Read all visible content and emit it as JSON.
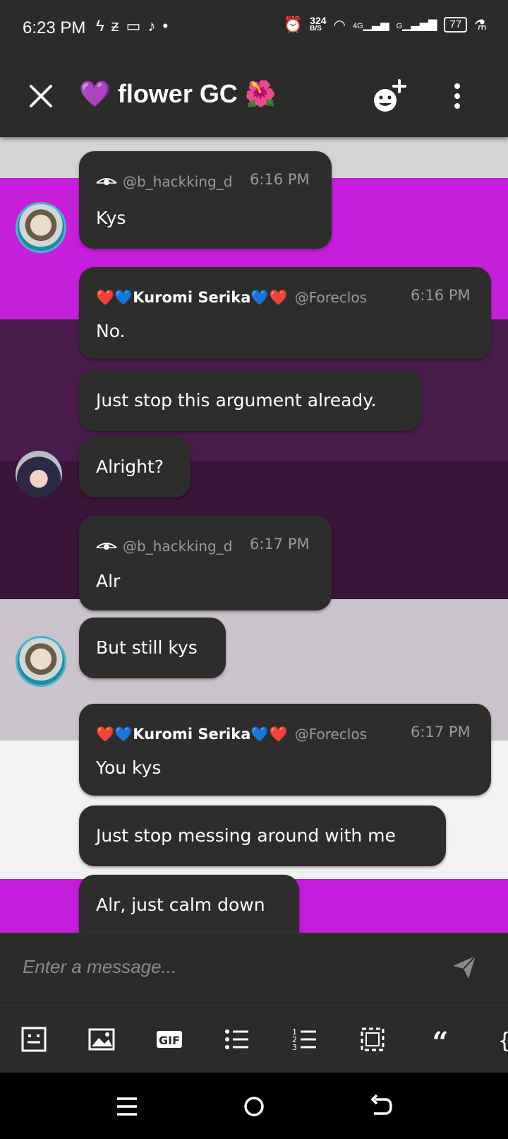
{
  "status_bar": {
    "time": "6:23 PM",
    "left_icons": [
      "lightning-icon",
      "deviantart-icon",
      "voicemail-icon",
      "tiktok-icon",
      "dot-icon"
    ],
    "net_speed_value": "324",
    "net_speed_unit": "B/S",
    "net_4g": "4G",
    "net_g": "G",
    "battery": "77"
  },
  "header": {
    "title": "💜 flower GC 🌺"
  },
  "messages": [
    {
      "group": 1,
      "author": "@b_hackking_d",
      "time": "6:16 PM",
      "text": "Kys"
    },
    {
      "group": 2,
      "author_name": "❤️💙Kuromi Serika💙❤️",
      "author_handle": "@Foreclos",
      "time": "6:16 PM",
      "text": "No."
    },
    {
      "group": 2,
      "text": "Just stop this argument already."
    },
    {
      "group": 2,
      "text": "Alright?"
    },
    {
      "group": 3,
      "author": "@b_hackking_d",
      "time": "6:17 PM",
      "text": "Alr"
    },
    {
      "group": 3,
      "text": "But still kys"
    },
    {
      "group": 4,
      "author_name": "❤️💙Kuromi Serika💙❤️",
      "author_handle": "@Foreclos",
      "time": "6:17 PM",
      "text": "You kys"
    },
    {
      "group": 4,
      "text": "Just stop messing around with me"
    },
    {
      "group": 4,
      "text": "Alr, just calm down"
    }
  ],
  "composer": {
    "placeholder": "Enter a message..."
  },
  "toolbar_icons": [
    "emoji-keyboard-icon",
    "image-icon",
    "gif-icon",
    "bullet-list-icon",
    "numbered-list-icon",
    "selection-icon",
    "quote-icon",
    "code-brace-icon"
  ],
  "colors": {
    "bar_bg": "#2b2b29",
    "bubble_bg": "#2d2d2b",
    "magenta": "#c21bd9",
    "dark_purple": "#3d1640",
    "lavender": "#cfc8cf"
  }
}
